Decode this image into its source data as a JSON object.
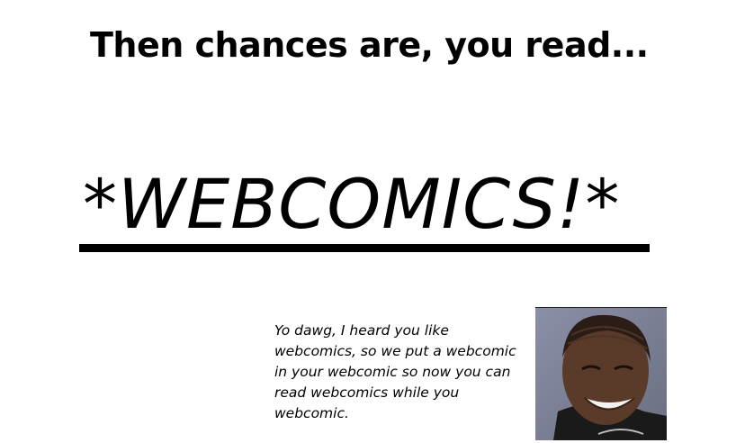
{
  "heading": "Then chances are, you read...",
  "big_text": "*WEBCOMICS!*",
  "caption_lines": [
    "Yo dawg, I heard you like",
    "webcomics, so we put a webcomic",
    "in your webcomic so now you can",
    "read webcomics while you",
    "webcomic."
  ]
}
